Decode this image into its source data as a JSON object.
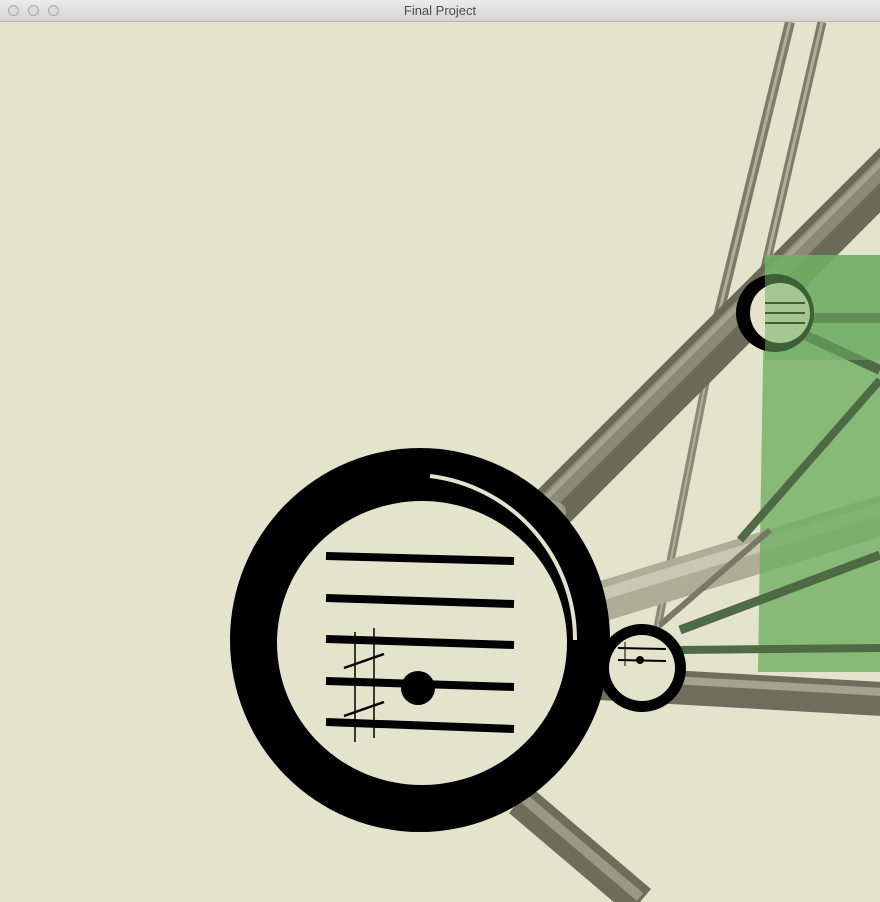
{
  "window": {
    "title": "Final Project",
    "controls": [
      "close-button",
      "minimize-button",
      "zoom-button"
    ]
  },
  "scene": {
    "background_color": "#e4e3cc",
    "rod_color": "#7a7966",
    "rod_highlight_color": "#b8b7a0",
    "ring_color": "#000000",
    "overlay_color": "#6fae62"
  }
}
